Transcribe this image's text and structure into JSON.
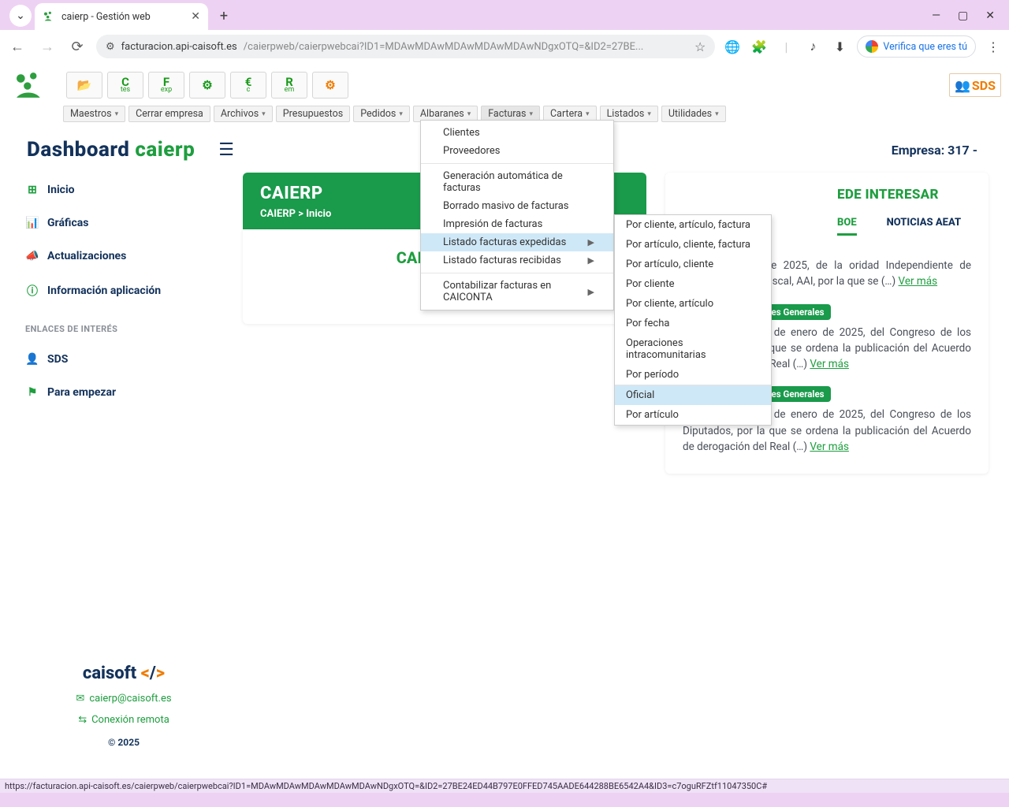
{
  "browser": {
    "tab_title": "caierp - Gestión web",
    "url_host": "facturacion.api-caisoft.es",
    "url_path": "/caierpweb/caierpwebcai?ID1=MDAwMDAwMDAwMDAwMDAwNDgxOTQ=&ID2=27BE...",
    "verify": "Verifica que eres tú",
    "status_url": "https://facturacion.api-caisoft.es/caierpweb/caierpwebcai?ID1=MDAwMDAwMDAwMDAwMDAwNDgxOTQ=&ID2=27BE24ED44B797E0FFED745AADE644288BE6542A4&ID3=c7oguRFZtf11047350C#"
  },
  "menubar": [
    "Maestros",
    "Cerrar empresa",
    "Archivos",
    "Presupuestos",
    "Pedidos",
    "Albaranes",
    "Facturas",
    "Cartera",
    "Listados",
    "Utilidades"
  ],
  "menubar_nochev": [
    1,
    3
  ],
  "dd1": {
    "groups": [
      [
        "Clientes",
        "Proveedores"
      ],
      [
        "Generación automática de facturas",
        "Borrado masivo de facturas",
        "Impresión de facturas",
        "Listado facturas expedidas",
        "Listado facturas recibidas"
      ],
      [
        "Contabilizar facturas en CAICONTA"
      ]
    ],
    "submenu_rows": [
      "Listado facturas expedidas",
      "Listado facturas recibidas",
      "Contabilizar facturas en CAICONTA"
    ],
    "highlight": "Listado facturas expedidas"
  },
  "dd2": {
    "items": [
      "Por cliente, artículo, factura",
      "Por artículo, cliente, factura",
      "Por artículo, cliente",
      "Por cliente",
      "Por cliente, artículo",
      "Por fecha",
      "Operaciones intracomunitarias",
      "Por período",
      "Oficial",
      "Por artículo"
    ],
    "highlight": "Oficial",
    "sep_after": "Oficial_prev"
  },
  "dashboard": {
    "title_a": "Dashboard ",
    "title_b": "caierp",
    "empresa": "Empresa: 317 -"
  },
  "sidebar": {
    "items": [
      {
        "icon": "⊞",
        "label": "Inicio"
      },
      {
        "icon": "📊",
        "label": "Gráficas"
      },
      {
        "icon": "📣",
        "label": "Actualizaciones"
      },
      {
        "icon": "ⓘ",
        "label": "Información aplicación"
      }
    ],
    "section": "ENLACES DE INTERÉS",
    "items2": [
      {
        "icon": "👤",
        "label": "SDS"
      },
      {
        "icon": "⚑",
        "label": "Para empezar"
      }
    ],
    "footer_brand": "caisoft",
    "email": "caierp@caisoft.es",
    "remote": "Conexión remota",
    "copyright": "© 2025"
  },
  "page": {
    "heading": "CAIERP",
    "breadcrumb": "CAIERP  >  Inicio",
    "left_card": "CAICONECTA",
    "interest_title": "EDE INTERESAR",
    "tabs": [
      "BOE",
      "NOTICIAS AEAT"
    ],
    "active_tab": "BOE"
  },
  "news": [
    {
      "badge_visible": false,
      "text_trail": "e 20 de enero de 2025, de la oridad Independiente de Responsabilidad Fiscal, AAI, por la que se (…) ",
      "more": "Ver más"
    },
    {
      "badge": "23/1/2025 - Cortes Generales",
      "text": "Resolución de 22 de enero de 2025, del Congreso de los Diputados, por la que se ordena la publicación del Acuerdo de derogación del Real (…) ",
      "more": "Ver más"
    },
    {
      "badge": "23/1/2025 - Cortes Generales",
      "text": "Resolución de 22 de enero de 2025, del Congreso de los Diputados, por la que se ordena la publicación del Acuerdo de derogación del Real (…) ",
      "more": "Ver más"
    }
  ],
  "toolbar_buttons": [
    {
      "t": "📂",
      "sub": "",
      "cls": "green"
    },
    {
      "t": "C",
      "sub": "tes",
      "cls": "green"
    },
    {
      "t": "F",
      "sub": "exp",
      "cls": "green"
    },
    {
      "t": "⚙",
      "sub": "",
      "cls": "green"
    },
    {
      "t": "€",
      "sub": "c",
      "cls": "green"
    },
    {
      "t": "R",
      "sub": "em",
      "cls": "green"
    },
    {
      "t": "⚙",
      "sub": "",
      "cls": "orange"
    }
  ],
  "sds": "SDS"
}
